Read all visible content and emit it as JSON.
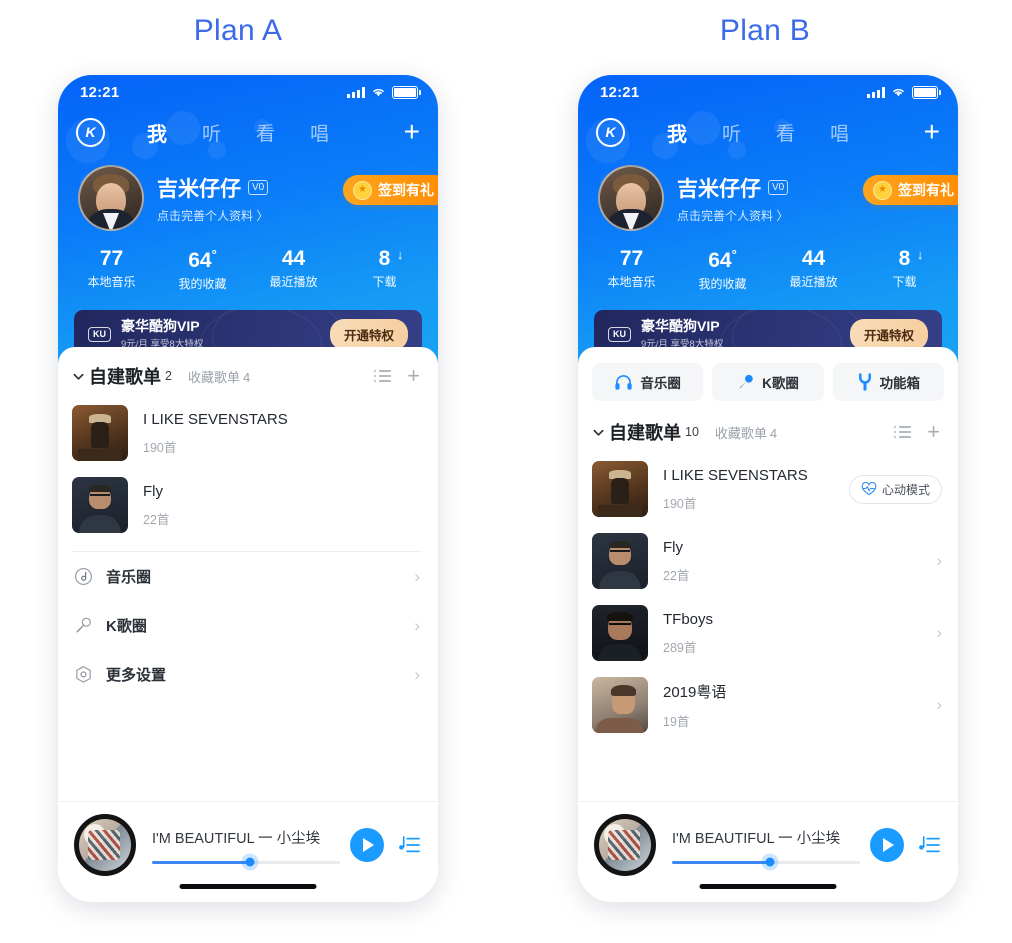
{
  "page": {
    "title_color": "#3b6bea",
    "plan_a_label": "Plan A",
    "plan_b_label": "Plan B"
  },
  "status_bar": {
    "time": "12:21"
  },
  "nav": {
    "logo": "K",
    "tabs": [
      {
        "label": "我",
        "active": true
      },
      {
        "label": "听",
        "active": false
      },
      {
        "label": "看",
        "active": false
      },
      {
        "label": "唱",
        "active": false
      }
    ],
    "add_label": "+"
  },
  "profile": {
    "name": "吉米仔仔",
    "badge": "V0",
    "subtitle": "点击完善个人资料 〉",
    "checkin_label": "签到有礼"
  },
  "stats": [
    {
      "value": "77",
      "sup": "",
      "label": "本地音乐"
    },
    {
      "value": "64",
      "sup": "°",
      "label": "我的收藏"
    },
    {
      "value": "44",
      "sup": "",
      "label": "最近播放"
    },
    {
      "value": "8",
      "sup": "",
      "label": "下载",
      "download_arrow": "↓"
    }
  ],
  "vip": {
    "tag": "KU",
    "title": "豪华酷狗VIP",
    "subtitle": "9元/月 享受8大特权",
    "button": "开通特权"
  },
  "plan_a": {
    "section": {
      "title": "自建歌单",
      "count": "2",
      "alt_title": "收藏歌单",
      "alt_count": "4"
    },
    "playlists": [
      {
        "name": "I LIKE SEVENSTARS",
        "count": "190首"
      },
      {
        "name": "Fly",
        "count": "22首"
      }
    ],
    "menu": [
      {
        "label": "音乐圈",
        "icon": "music-circle-icon"
      },
      {
        "label": "K歌圈",
        "icon": "microphone-icon"
      },
      {
        "label": "更多设置",
        "icon": "settings-icon"
      }
    ]
  },
  "plan_b": {
    "chips": [
      {
        "label": "音乐圈",
        "icon": "headphone-icon"
      },
      {
        "label": "K歌圈",
        "icon": "microphone-icon"
      },
      {
        "label": "功能箱",
        "icon": "wrench-icon"
      }
    ],
    "section": {
      "title": "自建歌单",
      "count": "10",
      "alt_title": "收藏歌单",
      "alt_count": "4"
    },
    "playlists": [
      {
        "name": "I LIKE SEVENSTARS",
        "count": "190首",
        "badge": "心动模式"
      },
      {
        "name": "Fly",
        "count": "22首",
        "badge": ""
      },
      {
        "name": "TFboys",
        "count": "289首",
        "badge": ""
      },
      {
        "name": "2019粤语",
        "count": "19首",
        "badge": ""
      }
    ]
  },
  "player": {
    "track_title": "I'M BEAUTIFUL 一 小尘埃",
    "progress_percent": 52
  },
  "colors": {
    "header_top": "#0563f9",
    "header_bottom": "#18a4f4",
    "accent_blue": "#1a9bff",
    "vip_bg": "#2c3676",
    "vip_button": "#f6cfa1",
    "checkin_orange": "#ff8a00",
    "title_blue": "#3b6bea"
  }
}
